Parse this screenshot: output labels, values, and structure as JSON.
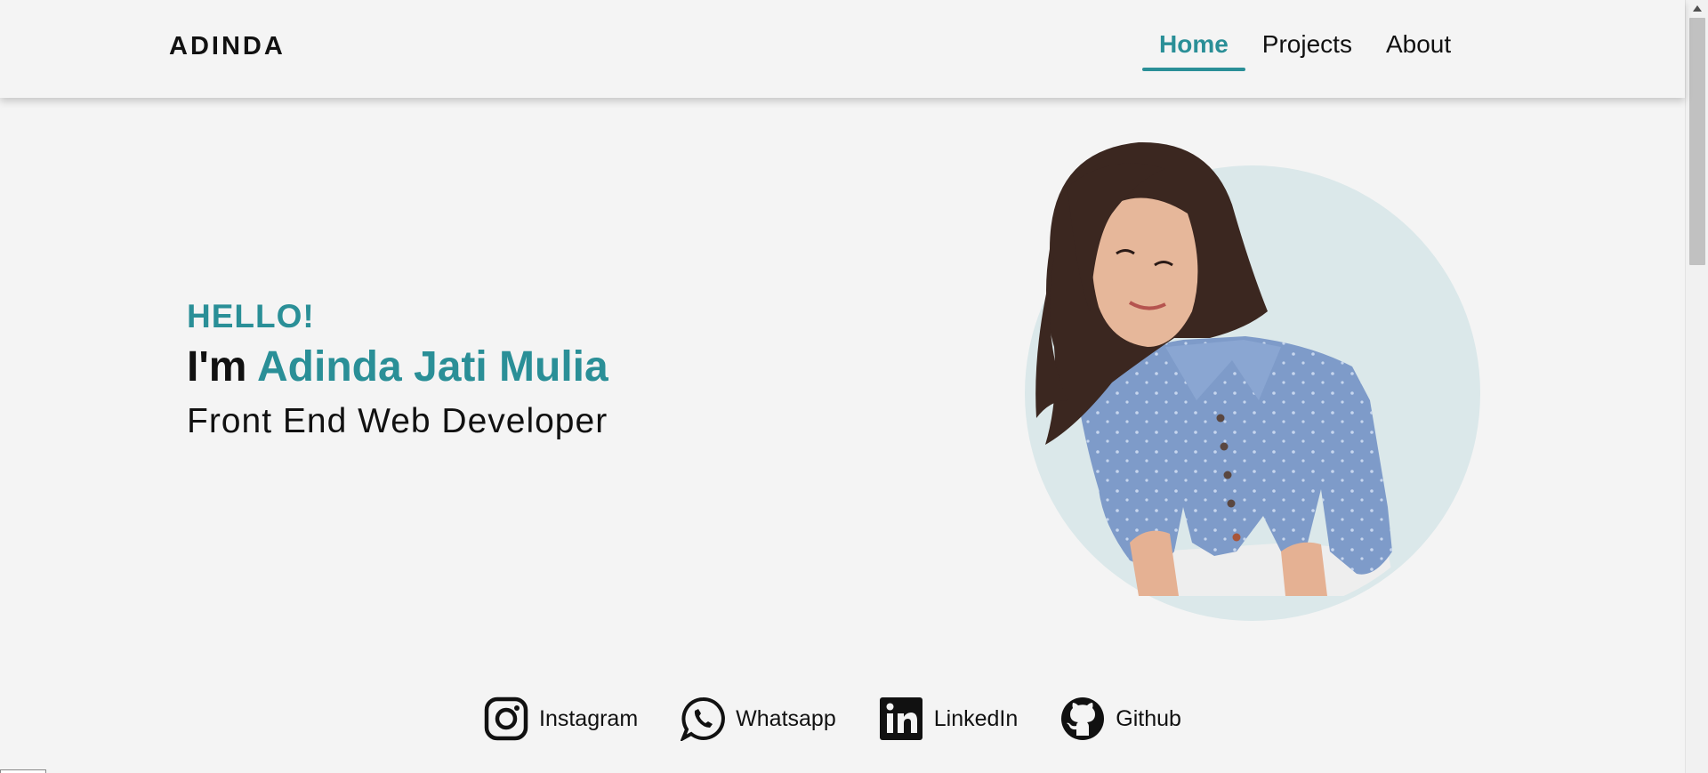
{
  "header": {
    "brand": "ADINDA",
    "nav": [
      {
        "label": "Home"
      },
      {
        "label": "Projects"
      },
      {
        "label": "About"
      }
    ]
  },
  "hero": {
    "greeting": "HELLO!",
    "intro_prefix": "I'm",
    "name": "Adinda Jati Mulia",
    "role": "Front End Web Developer"
  },
  "socials": [
    {
      "label": "Instagram",
      "icon": "instagram-icon"
    },
    {
      "label": "Whatsapp",
      "icon": "whatsapp-icon"
    },
    {
      "label": "LinkedIn",
      "icon": "linkedin-icon"
    },
    {
      "label": "Github",
      "icon": "github-icon"
    }
  ],
  "colors": {
    "accent": "#2a8f97",
    "background": "#f4f4f4",
    "photo_circle": "#dbe8ea",
    "text": "#111111"
  }
}
